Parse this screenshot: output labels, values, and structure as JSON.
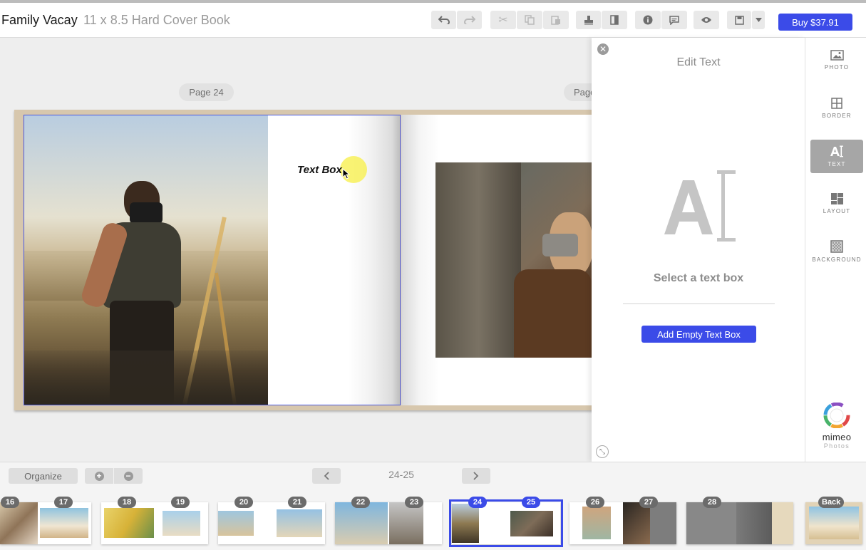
{
  "header": {
    "title": "Family Vacay",
    "subtitle": "11 x 8.5 Hard Cover Book",
    "buy_label": "Buy $37.91"
  },
  "canvas": {
    "left_page_label": "Page 24",
    "right_page_label": "Page",
    "text_box_text": "Text Box"
  },
  "edit_panel": {
    "title": "Edit Text",
    "hint": "Select a text box",
    "add_button": "Add Empty Text Box"
  },
  "tools": [
    {
      "label": "PHOTO",
      "icon": "photo-icon"
    },
    {
      "label": "BORDER",
      "icon": "border-icon"
    },
    {
      "label": "TEXT",
      "icon": "text-icon",
      "active": true
    },
    {
      "label": "LAYOUT",
      "icon": "layout-icon"
    },
    {
      "label": "BACKGROUND",
      "icon": "background-icon"
    }
  ],
  "brand": {
    "name": "mimeo",
    "sub": "Photos"
  },
  "bottom_bar": {
    "organize_label": "Organize",
    "page_indicator": "24-25"
  },
  "thumbnails": [
    {
      "pages": [
        "16",
        "17"
      ]
    },
    {
      "pages": [
        "18",
        "19"
      ]
    },
    {
      "pages": [
        "20",
        "21"
      ]
    },
    {
      "pages": [
        "22",
        "23"
      ]
    },
    {
      "pages": [
        "24",
        "25"
      ],
      "selected": true
    },
    {
      "pages": [
        "26",
        "27"
      ]
    },
    {
      "pages": [
        "28"
      ]
    },
    {
      "pages": [
        "Back"
      ]
    }
  ],
  "colors": {
    "accent": "#3b4be8",
    "toolbar_button": "#e9e9e9",
    "active_tool": "#a6a6a6"
  }
}
